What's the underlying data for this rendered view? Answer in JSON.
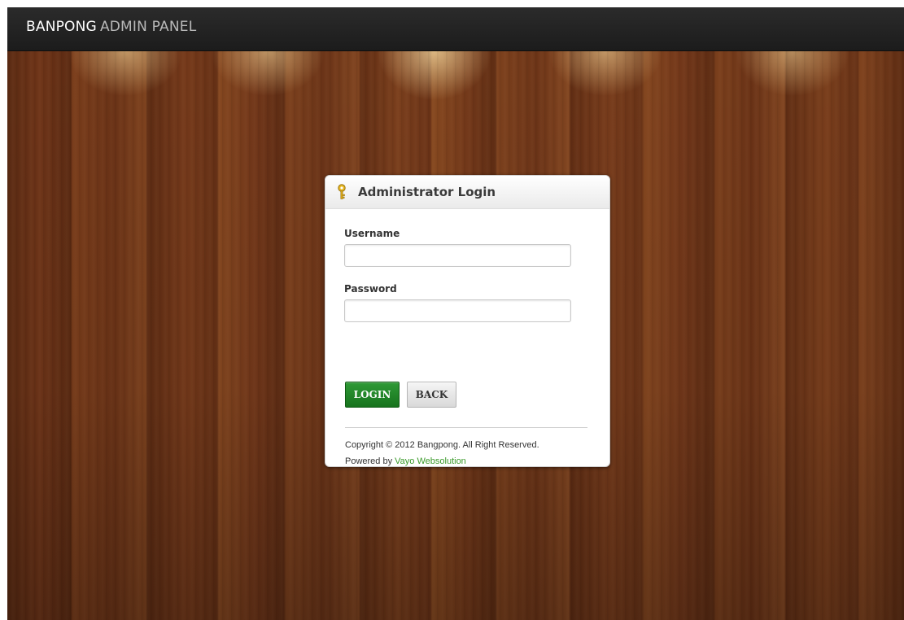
{
  "header": {
    "brand_strong": "BANPONG",
    "brand_light": "ADMIN PANEL"
  },
  "login": {
    "title": "Administrator Login",
    "title_icon": "key-icon",
    "username_label": "Username",
    "username_value": "",
    "password_label": "Password",
    "password_value": "",
    "login_button": "LOGIN",
    "back_button": "BACK"
  },
  "footer": {
    "copyright": "Copyright © 2012 Bangpong. All Right Reserved.",
    "powered_prefix": "Powered by",
    "powered_link": "Vayo Websolution"
  },
  "colors": {
    "topbar": "#1c1c1c",
    "login_button": "#17731d",
    "link": "#3a9a2a"
  }
}
